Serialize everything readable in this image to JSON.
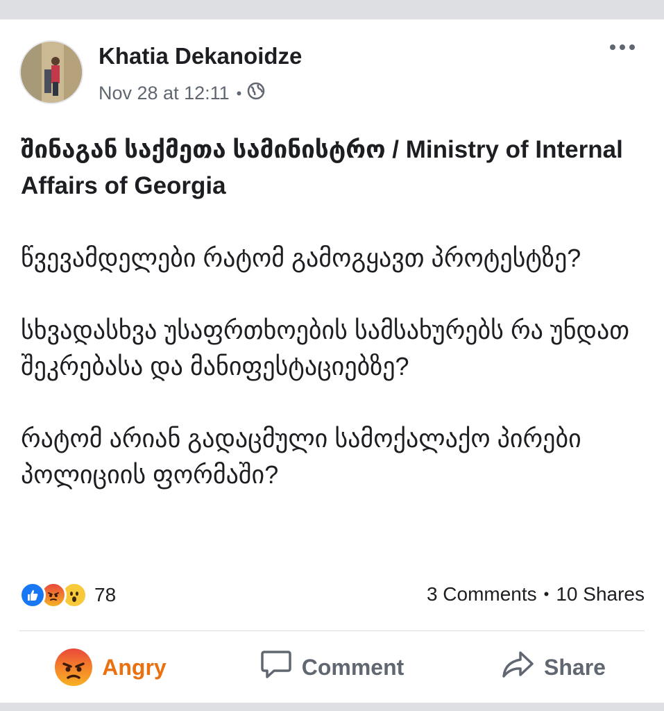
{
  "post": {
    "author": "Khatia Dekanoidze",
    "timestamp": "Nov 28 at 12:11",
    "meta_separator": "•",
    "privacy_icon": "globe-icon",
    "shared_page": "შინაგან საქმეთა სამინისტრო / Ministry of Internal Affairs of Georgia",
    "paragraphs": [
      "წვევამდელები რატომ გამოგყავთ პროტესტზე?",
      "სხვადასხვა უსაფრთხოების სამსახურებს რა უნდათ შეკრებასა და მანიფესტაციებზე?",
      "რატომ არიან გადაცმული სამოქალაქო პირები პოლიციის ფორმაში?"
    ]
  },
  "reactions": {
    "icons": [
      "like-icon",
      "angry-icon",
      "wow-icon"
    ],
    "count": "78"
  },
  "stats": {
    "comments": "3 Comments",
    "separator": "•",
    "shares": "10 Shares"
  },
  "actions": {
    "react_label": "Angry",
    "comment_label": "Comment",
    "share_label": "Share"
  },
  "colors": {
    "angry_accent": "#e9710f",
    "like_blue": "#1877f2",
    "secondary_text": "#606770"
  }
}
